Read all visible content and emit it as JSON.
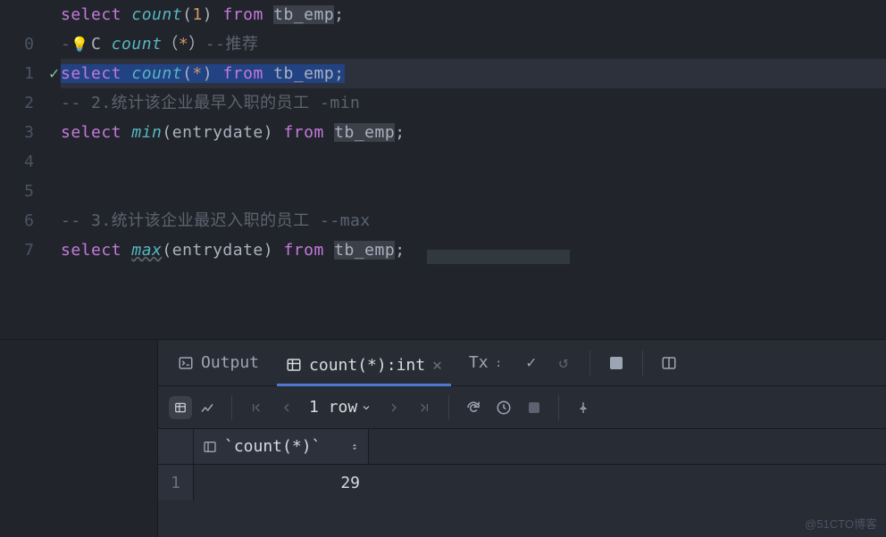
{
  "gutter": [
    "",
    "0",
    "1",
    "2",
    "3",
    "4",
    "5",
    "6",
    "7"
  ],
  "code": {
    "l0": {
      "kw1": "select",
      "fn": "count",
      "lp": "(",
      "arg": "1",
      "rp": ")",
      "kw2": "from",
      "tbl": "tb_emp",
      "sc": ";"
    },
    "l1": {
      "pre": "-",
      "c": "C",
      "fn": "count",
      "lp": "(",
      "star": "*",
      "rp": ")",
      "cm": "--推荐"
    },
    "l2": {
      "kw1": "select",
      "fn": "count",
      "lp": "(",
      "star": "*",
      "rp": ")",
      "kw2": "from",
      "tbl": "tb_emp",
      "sc": ";"
    },
    "l3": {
      "cm": "-- 2.统计该企业最早入职的员工 -min"
    },
    "l4": {
      "kw1": "select",
      "fn": "min",
      "lp": "(",
      "arg": "entrydate",
      "rp": ")",
      "kw2": "from",
      "tbl": "tb_emp",
      "sc": ";"
    },
    "l6": {
      "cm": "-- 3.统计该企业最迟入职的员工 --max"
    },
    "l7": {
      "kw1": "select",
      "fn": "max",
      "lp": "(",
      "arg": "entrydate",
      "rp": ")",
      "kw2": "from",
      "tbl": "tb_emp",
      "sc": ";"
    }
  },
  "tabs": {
    "output": "Output",
    "result": "count(*):int",
    "tx": "Tx"
  },
  "toolbar": {
    "rows": "1 row"
  },
  "table": {
    "header": "`count(*)`",
    "rownum": "1",
    "value": "29"
  },
  "watermark": "@51CTO博客",
  "colors": {
    "bg": "#21252b",
    "accent": "#4d78cc"
  }
}
